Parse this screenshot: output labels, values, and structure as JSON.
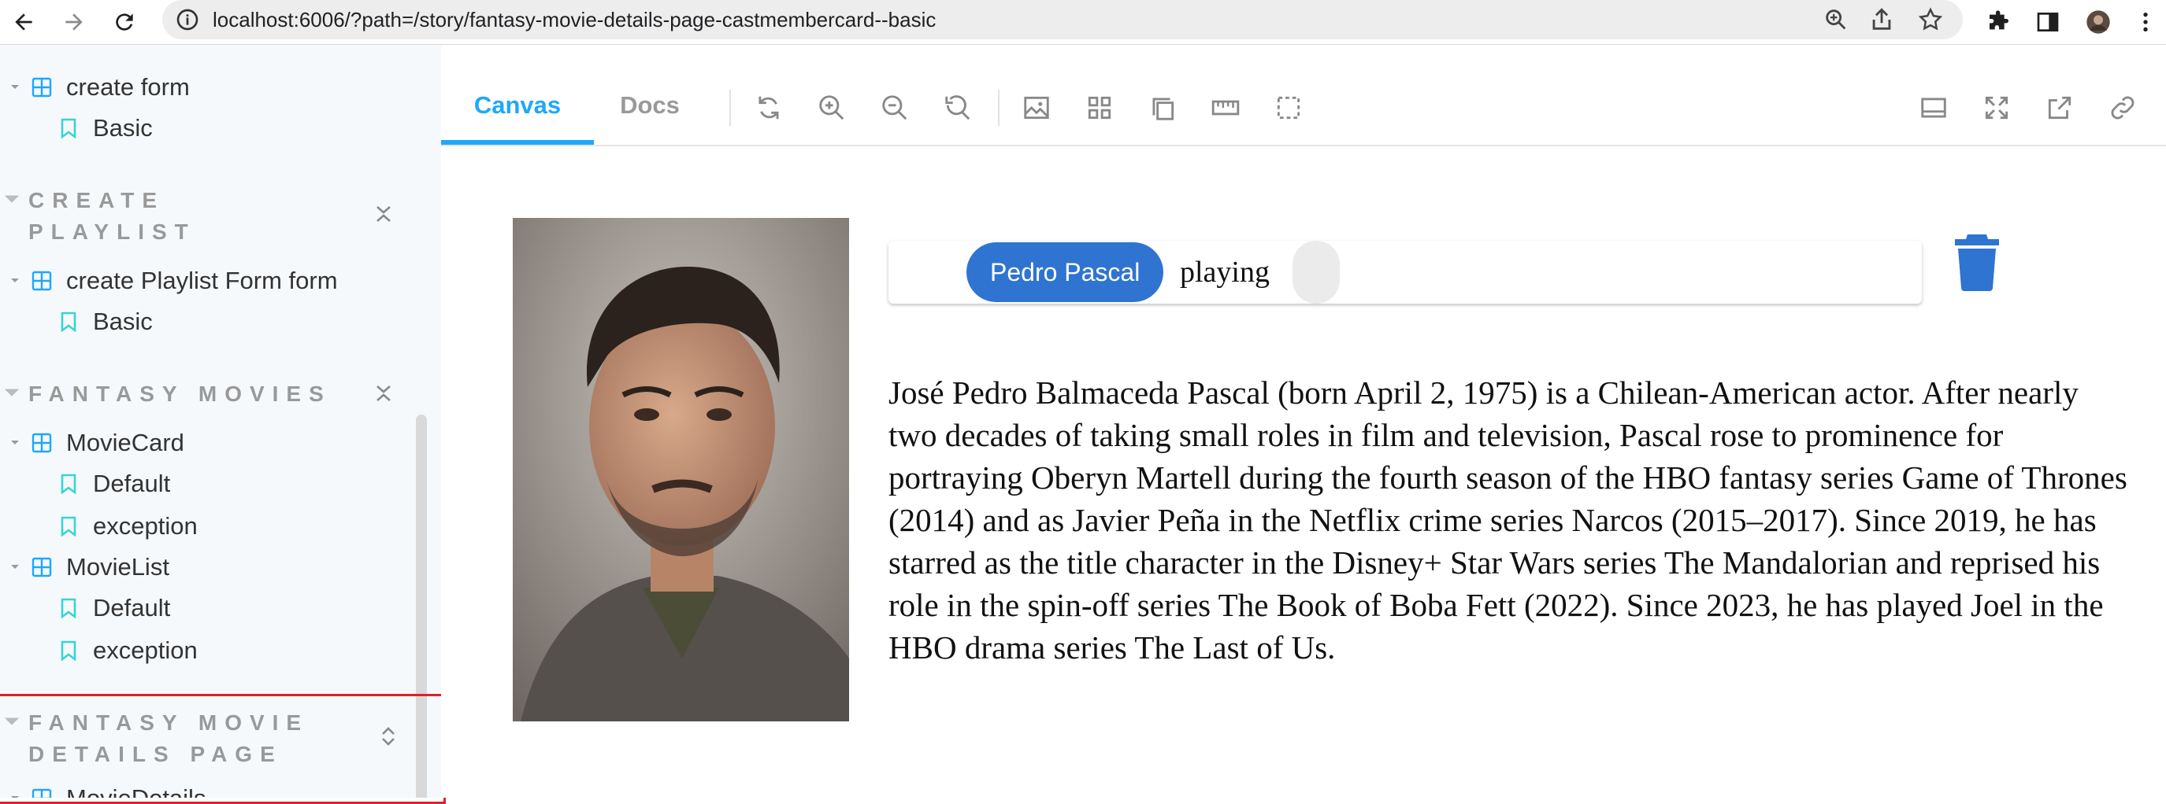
{
  "browser": {
    "url": "localhost:6006/?path=/story/fantasy-movie-details-page-castmembercard--basic"
  },
  "sidebar": {
    "tree_top": [
      {
        "label": "create form",
        "type": "component"
      },
      {
        "label": "Basic",
        "type": "story"
      }
    ],
    "groups": [
      {
        "title_lines": [
          "CREATE",
          "PLAYLIST"
        ],
        "items": [
          {
            "label": "create Playlist Form form",
            "type": "component"
          },
          {
            "label": "Basic",
            "type": "story"
          }
        ]
      },
      {
        "title_lines": [
          "FANTASY MOVIES"
        ],
        "items": [
          {
            "label": "MovieCard",
            "type": "component"
          },
          {
            "label": "Default",
            "type": "story"
          },
          {
            "label": "exception",
            "type": "story"
          },
          {
            "label": "MovieList",
            "type": "component"
          },
          {
            "label": "Default",
            "type": "story"
          },
          {
            "label": "exception",
            "type": "story"
          }
        ]
      },
      {
        "title_lines": [
          "FANTASY MOVIE",
          "DETAILS PAGE"
        ],
        "items": [
          {
            "label": "MovieDetails",
            "type": "component"
          }
        ]
      }
    ]
  },
  "toolbar": {
    "tabs": [
      {
        "label": "Canvas",
        "active": true
      },
      {
        "label": "Docs",
        "active": false
      }
    ],
    "tools": [
      "reload-icon",
      "zoom-in-icon",
      "zoom-out-icon",
      "reset-zoom-icon",
      "background-icon",
      "grid-icon",
      "viewport-icon",
      "measure-icon",
      "outline-icon"
    ],
    "right_tools": [
      "addons-panel-icon",
      "fullscreen-icon",
      "open-new-tab-icon",
      "copy-link-icon"
    ],
    "accent_color": "#1ea7fd"
  },
  "cast_member_card": {
    "actor_name": "Pedro Pascal",
    "role_text": "playing",
    "character_name": "",
    "bio": "José Pedro Balmaceda Pascal (born April 2, 1975) is a Chilean-American actor. After nearly two decades of taking small roles in film and television, Pascal rose to prominence for portraying Oberyn Martell during the fourth season of the HBO fantasy series Game of Thrones (2014) and as Javier Peña in the Netflix crime series Narcos (2015–2017). Since 2019, he has starred as the title character in the Disney+ Star Wars series The Mandalorian and reprised his role in the spin-off series The Book of Boba Fett (2022). Since 2023, he has played Joel in the HBO drama series The Last of Us.",
    "chip_color": "#2f74d0",
    "delete_icon": "trash-icon"
  }
}
